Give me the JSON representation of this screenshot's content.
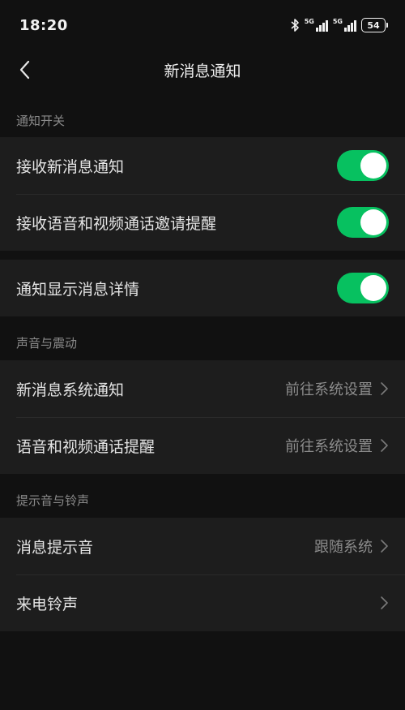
{
  "status_bar": {
    "time": "18:20",
    "network_1": "5G",
    "network_2": "5G",
    "battery": "54"
  },
  "nav": {
    "title": "新消息通知"
  },
  "sections": {
    "notify_switch": {
      "header": "通知开关",
      "rows": [
        {
          "label": "接收新消息通知",
          "toggle": true
        },
        {
          "label": "接收语音和视频通话邀请提醒",
          "toggle": true
        }
      ]
    },
    "details": {
      "rows": [
        {
          "label": "通知显示消息详情",
          "toggle": true
        }
      ]
    },
    "sound_vibration": {
      "header": "声音与震动",
      "rows": [
        {
          "label": "新消息系统通知",
          "value": "前往系统设置"
        },
        {
          "label": "语音和视频通话提醒",
          "value": "前往系统设置"
        }
      ]
    },
    "tones": {
      "header": "提示音与铃声",
      "rows": [
        {
          "label": "消息提示音",
          "value": "跟随系统"
        },
        {
          "label": "来电铃声",
          "value": ""
        }
      ]
    }
  },
  "colors": {
    "background": "#111111",
    "row_background": "#1d1d1d",
    "toggle_on": "#07c160",
    "secondary_text": "#8c8c8c"
  },
  "icons": {
    "back": "chevron-left-icon",
    "row_arrow": "chevron-right-icon",
    "bluetooth": "bluetooth-icon"
  }
}
